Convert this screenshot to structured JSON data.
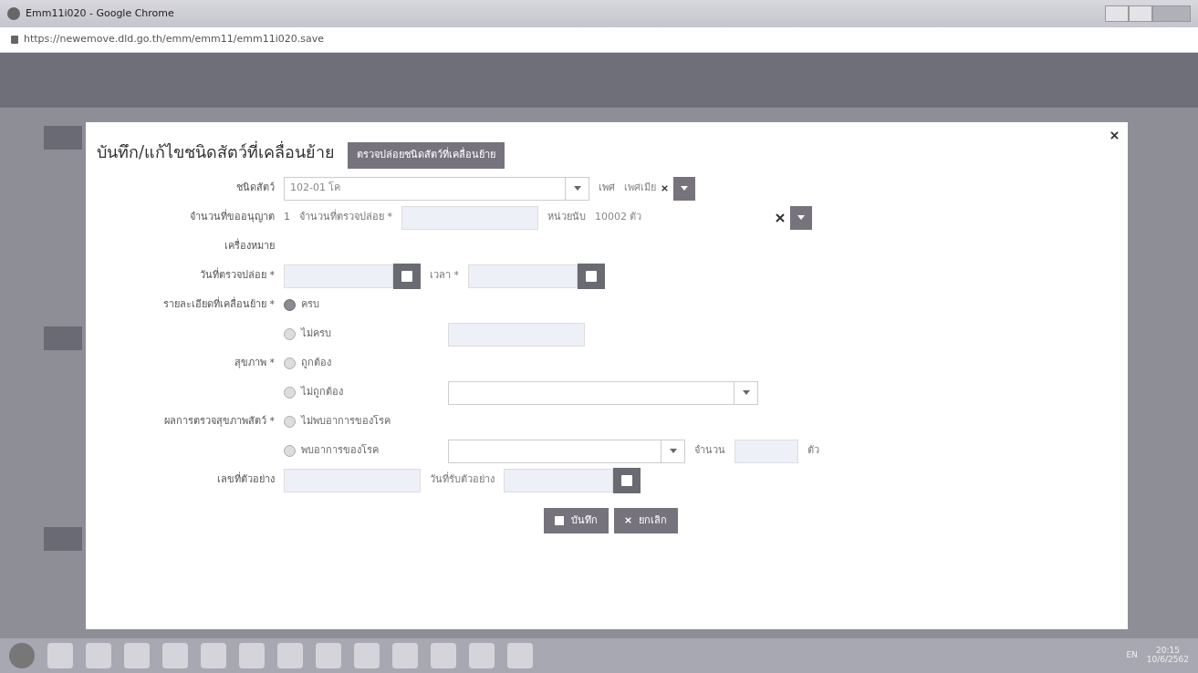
{
  "window": {
    "title": "Emm11i020 - Google Chrome",
    "url": "https://newemove.dld.go.th/emm/emm11/emm11i020.save"
  },
  "modal": {
    "title": "บันทึก/แก้ไขชนิดสัตว์ที่เคลื่อนย้าย",
    "section_button": "ตรวจปล่อยชนิดสัตว์ที่เคลื่อนย้าย",
    "rows": [
      {
        "items": [
          {
            "kind": "label",
            "text": "ชนิดสัตว์"
          },
          {
            "kind": "select",
            "value": "102-01 โค"
          },
          {
            "kind": "inline",
            "text": "เพศ"
          },
          {
            "kind": "tag",
            "value": "เพศเมีย"
          }
        ]
      },
      {
        "items": [
          {
            "kind": "label",
            "text": "จำนวนที่ขออนุญาต"
          },
          {
            "kind": "plain",
            "text": "1"
          },
          {
            "kind": "inline",
            "text": "จำนวนที่ตรวจปล่อย *"
          },
          {
            "kind": "input"
          },
          {
            "kind": "inline",
            "text": "หน่วยนับ"
          },
          {
            "kind": "tagwide",
            "value": "10002 ตัว"
          }
        ]
      },
      {
        "items": [
          {
            "kind": "label",
            "text": "เครื่องหมาย"
          }
        ]
      },
      {
        "items": [
          {
            "kind": "label",
            "text": "วันที่ตรวจปล่อย *"
          },
          {
            "kind": "date"
          },
          {
            "kind": "inline",
            "text": "เวลา *"
          },
          {
            "kind": "date"
          }
        ]
      },
      {
        "items": [
          {
            "kind": "label",
            "text": "รายละเอียดที่เคลื่อนย้าย *"
          },
          {
            "kind": "radio",
            "text": "ครบ",
            "selected": true
          }
        ]
      },
      {
        "items": [
          {
            "kind": "label"
          },
          {
            "kind": "radio",
            "text": "ไม่ครบ",
            "selected": false
          },
          {
            "kind": "input"
          }
        ]
      },
      {
        "items": [
          {
            "kind": "label",
            "text": "สุขภาพ *"
          },
          {
            "kind": "radio",
            "text": "ถูกต้อง",
            "selected": false
          }
        ]
      },
      {
        "items": [
          {
            "kind": "label"
          },
          {
            "kind": "radio",
            "text": "ไม่ถูกต้อง",
            "selected": false
          },
          {
            "kind": "selectwide"
          }
        ]
      },
      {
        "items": [
          {
            "kind": "label",
            "text": "ผลการตรวจสุขภาพสัตว์ *"
          },
          {
            "kind": "radio",
            "text": "ไม่พบอาการของโรค",
            "selected": false
          }
        ]
      },
      {
        "items": [
          {
            "kind": "label"
          },
          {
            "kind": "radio",
            "text": "พบอาการของโรค",
            "selected": false
          },
          {
            "kind": "selectempty"
          },
          {
            "kind": "inline",
            "text": "จำนวน"
          },
          {
            "kind": "small"
          },
          {
            "kind": "plain",
            "text": "ตัว"
          }
        ]
      },
      {
        "items": [
          {
            "kind": "label",
            "text": "เลขที่ตัวอย่าง"
          },
          {
            "kind": "input"
          },
          {
            "kind": "inline",
            "text": "วันที่รับตัวอย่าง"
          },
          {
            "kind": "date"
          }
        ]
      }
    ],
    "buttons": [
      {
        "kind": "save",
        "label": "บันทึก"
      },
      {
        "kind": "cancel",
        "label": "ยกเลิก"
      }
    ]
  },
  "taskbar": {
    "language": "EN",
    "time": "20:15",
    "date": "10/6/2562"
  }
}
